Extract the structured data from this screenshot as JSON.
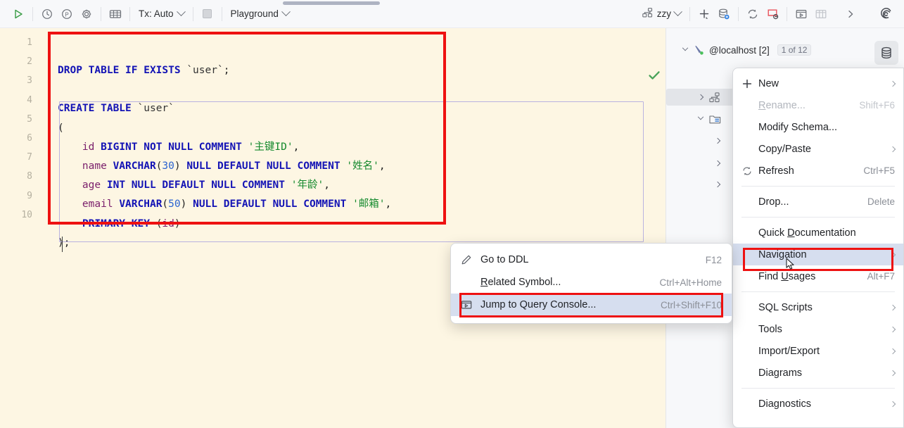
{
  "toolbar": {
    "run_icon": "run-triangle-icon",
    "history_icon": "history-clock-icon",
    "profile_icon": "profiler-p-icon",
    "settings_icon": "gear-icon",
    "grid_icon": "data-grid-icon",
    "tx_label": "Tx: Auto",
    "stop_icon": "stop-square-icon",
    "schema_label": "Playground",
    "session_icon": "session-nodes-icon",
    "session_label": "zzy",
    "add_icon": "plus-icon",
    "datasource_icon": "database-add-icon",
    "sync_icon": "refresh-sync-icon",
    "stop_refresh_icon": "cancel-refresh-icon",
    "console_icon": "open-console-icon",
    "table_icon": "table-grid-icon",
    "more_icon": "chevron-right-icon",
    "ai_icon": "ai-assistant-icon"
  },
  "editor": {
    "line_numbers": [
      "1",
      "2",
      "3",
      "4",
      "5",
      "6",
      "7",
      "8",
      "9",
      "10"
    ],
    "lines": [
      {
        "n": 1,
        "tokens": [
          {
            "t": "DROP TABLE IF EXISTS ",
            "c": "kw"
          },
          {
            "t": "`user`",
            "c": "tick"
          },
          {
            "t": ";",
            "c": "plain"
          }
        ]
      },
      {
        "n": 2,
        "tokens": [
          {
            "t": "",
            "c": "plain"
          }
        ]
      },
      {
        "n": 3,
        "tokens": [
          {
            "t": "CREATE TABLE ",
            "c": "kw"
          },
          {
            "t": "`user`",
            "c": "tick"
          }
        ]
      },
      {
        "n": 4,
        "tokens": [
          {
            "t": "(",
            "c": "plain"
          }
        ]
      },
      {
        "n": 5,
        "tokens": [
          {
            "t": "    ",
            "c": "plain"
          },
          {
            "t": "id",
            "c": "ident"
          },
          {
            "t": " ",
            "c": "plain"
          },
          {
            "t": "BIGINT NOT NULL COMMENT ",
            "c": "kw"
          },
          {
            "t": "'主键ID'",
            "c": "str"
          },
          {
            "t": ",",
            "c": "plain"
          }
        ]
      },
      {
        "n": 6,
        "tokens": [
          {
            "t": "    ",
            "c": "plain"
          },
          {
            "t": "name",
            "c": "ident"
          },
          {
            "t": " ",
            "c": "plain"
          },
          {
            "t": "VARCHAR",
            "c": "kw"
          },
          {
            "t": "(",
            "c": "plain"
          },
          {
            "t": "30",
            "c": "num"
          },
          {
            "t": ") ",
            "c": "plain"
          },
          {
            "t": "NULL DEFAULT NULL COMMENT ",
            "c": "kw"
          },
          {
            "t": "'姓名'",
            "c": "str"
          },
          {
            "t": ",",
            "c": "plain"
          }
        ]
      },
      {
        "n": 7,
        "tokens": [
          {
            "t": "    ",
            "c": "plain"
          },
          {
            "t": "age",
            "c": "ident"
          },
          {
            "t": " ",
            "c": "plain"
          },
          {
            "t": "INT NULL DEFAULT NULL COMMENT ",
            "c": "kw"
          },
          {
            "t": "'年龄'",
            "c": "str"
          },
          {
            "t": ",",
            "c": "plain"
          }
        ]
      },
      {
        "n": 8,
        "tokens": [
          {
            "t": "    ",
            "c": "plain"
          },
          {
            "t": "email",
            "c": "ident"
          },
          {
            "t": " ",
            "c": "plain"
          },
          {
            "t": "VARCHAR",
            "c": "kw"
          },
          {
            "t": "(",
            "c": "plain"
          },
          {
            "t": "50",
            "c": "num"
          },
          {
            "t": ") ",
            "c": "plain"
          },
          {
            "t": "NULL DEFAULT NULL COMMENT ",
            "c": "kw"
          },
          {
            "t": "'邮箱'",
            "c": "str"
          },
          {
            "t": ",",
            "c": "plain"
          }
        ]
      },
      {
        "n": 9,
        "tokens": [
          {
            "t": "    ",
            "c": "plain"
          },
          {
            "t": "PRIMARY KEY ",
            "c": "kw"
          },
          {
            "t": "(",
            "c": "plain"
          },
          {
            "t": "id",
            "c": "ident"
          },
          {
            "t": ")",
            "c": "plain"
          }
        ]
      },
      {
        "n": 10,
        "tokens": [
          {
            "t": ");",
            "c": "plain"
          }
        ]
      }
    ],
    "inspection_icon": "green-check-icon",
    "background_color": "#fdf6e3"
  },
  "db_tree": {
    "root": {
      "label": "@localhost [2]",
      "badge": "1 of 12",
      "icon": "datasource-localhost-icon",
      "expanded": true
    },
    "children": [
      {
        "label": "",
        "icon": "schema-nodes-icon",
        "expanded": false,
        "selected": true
      },
      {
        "label": "",
        "icon": "schema-folder-icon",
        "expanded": true
      },
      {
        "label": "",
        "icon": "",
        "expanded": false
      },
      {
        "label": "",
        "icon": "",
        "expanded": false
      },
      {
        "label": "",
        "icon": "",
        "expanded": false
      }
    ],
    "strip_button_icon": "database-explorer-icon"
  },
  "context_menu": {
    "items": [
      {
        "label": "New",
        "icon": "plus-icon",
        "shortcut": "",
        "submenu": true,
        "disabled": false,
        "selected": false
      },
      {
        "label": "Rename...",
        "icon": "",
        "shortcut": "Shift+F6",
        "submenu": false,
        "disabled": true,
        "selected": false,
        "mnemonic": "R"
      },
      {
        "label": "Modify Schema...",
        "icon": "",
        "shortcut": "",
        "submenu": false,
        "disabled": false,
        "selected": false
      },
      {
        "label": "Copy/Paste",
        "icon": "",
        "shortcut": "",
        "submenu": true,
        "disabled": false,
        "selected": false
      },
      {
        "label": "Refresh",
        "icon": "refresh-icon",
        "shortcut": "Ctrl+F5",
        "submenu": false,
        "disabled": false,
        "selected": false
      },
      {
        "separator": true
      },
      {
        "label": "Drop...",
        "icon": "",
        "shortcut": "Delete",
        "submenu": false,
        "disabled": false,
        "selected": false
      },
      {
        "separator": true
      },
      {
        "label": "Quick Documentation",
        "icon": "",
        "shortcut": "",
        "submenu": false,
        "disabled": false,
        "selected": false,
        "mnemonic": "D"
      },
      {
        "label": "Navigation",
        "icon": "",
        "shortcut": "",
        "submenu": true,
        "disabled": false,
        "selected": true
      },
      {
        "label": "Find Usages",
        "icon": "",
        "shortcut": "Alt+F7",
        "submenu": false,
        "disabled": false,
        "selected": false,
        "mnemonic": "U"
      },
      {
        "separator": true
      },
      {
        "label": "SQL Scripts",
        "icon": "",
        "shortcut": "",
        "submenu": true,
        "disabled": false,
        "selected": false
      },
      {
        "label": "Tools",
        "icon": "",
        "shortcut": "",
        "submenu": true,
        "disabled": false,
        "selected": false
      },
      {
        "label": "Import/Export",
        "icon": "",
        "shortcut": "",
        "submenu": true,
        "disabled": false,
        "selected": false
      },
      {
        "label": "Diagrams",
        "icon": "",
        "shortcut": "",
        "submenu": true,
        "disabled": false,
        "selected": false
      },
      {
        "separator": true
      },
      {
        "label": "Diagnostics",
        "icon": "",
        "shortcut": "",
        "submenu": true,
        "disabled": false,
        "selected": false
      }
    ]
  },
  "submenu": {
    "items": [
      {
        "label": "Go to DDL",
        "icon": "pencil-icon",
        "shortcut": "F12",
        "highlighted": false
      },
      {
        "label": "Related Symbol...",
        "icon": "",
        "shortcut": "Ctrl+Alt+Home",
        "highlighted": false,
        "mnemonic": "R"
      },
      {
        "label": "Jump to Query Console...",
        "icon": "console-window-icon",
        "shortcut": "Ctrl+Shift+F10",
        "highlighted": true
      }
    ]
  },
  "annotations": {
    "accent_color": "#ee1111",
    "sql_box": "red-highlight-sql",
    "nav_box": "red-highlight-navigation",
    "jump_box": "red-highlight-jump-to-query-console"
  }
}
